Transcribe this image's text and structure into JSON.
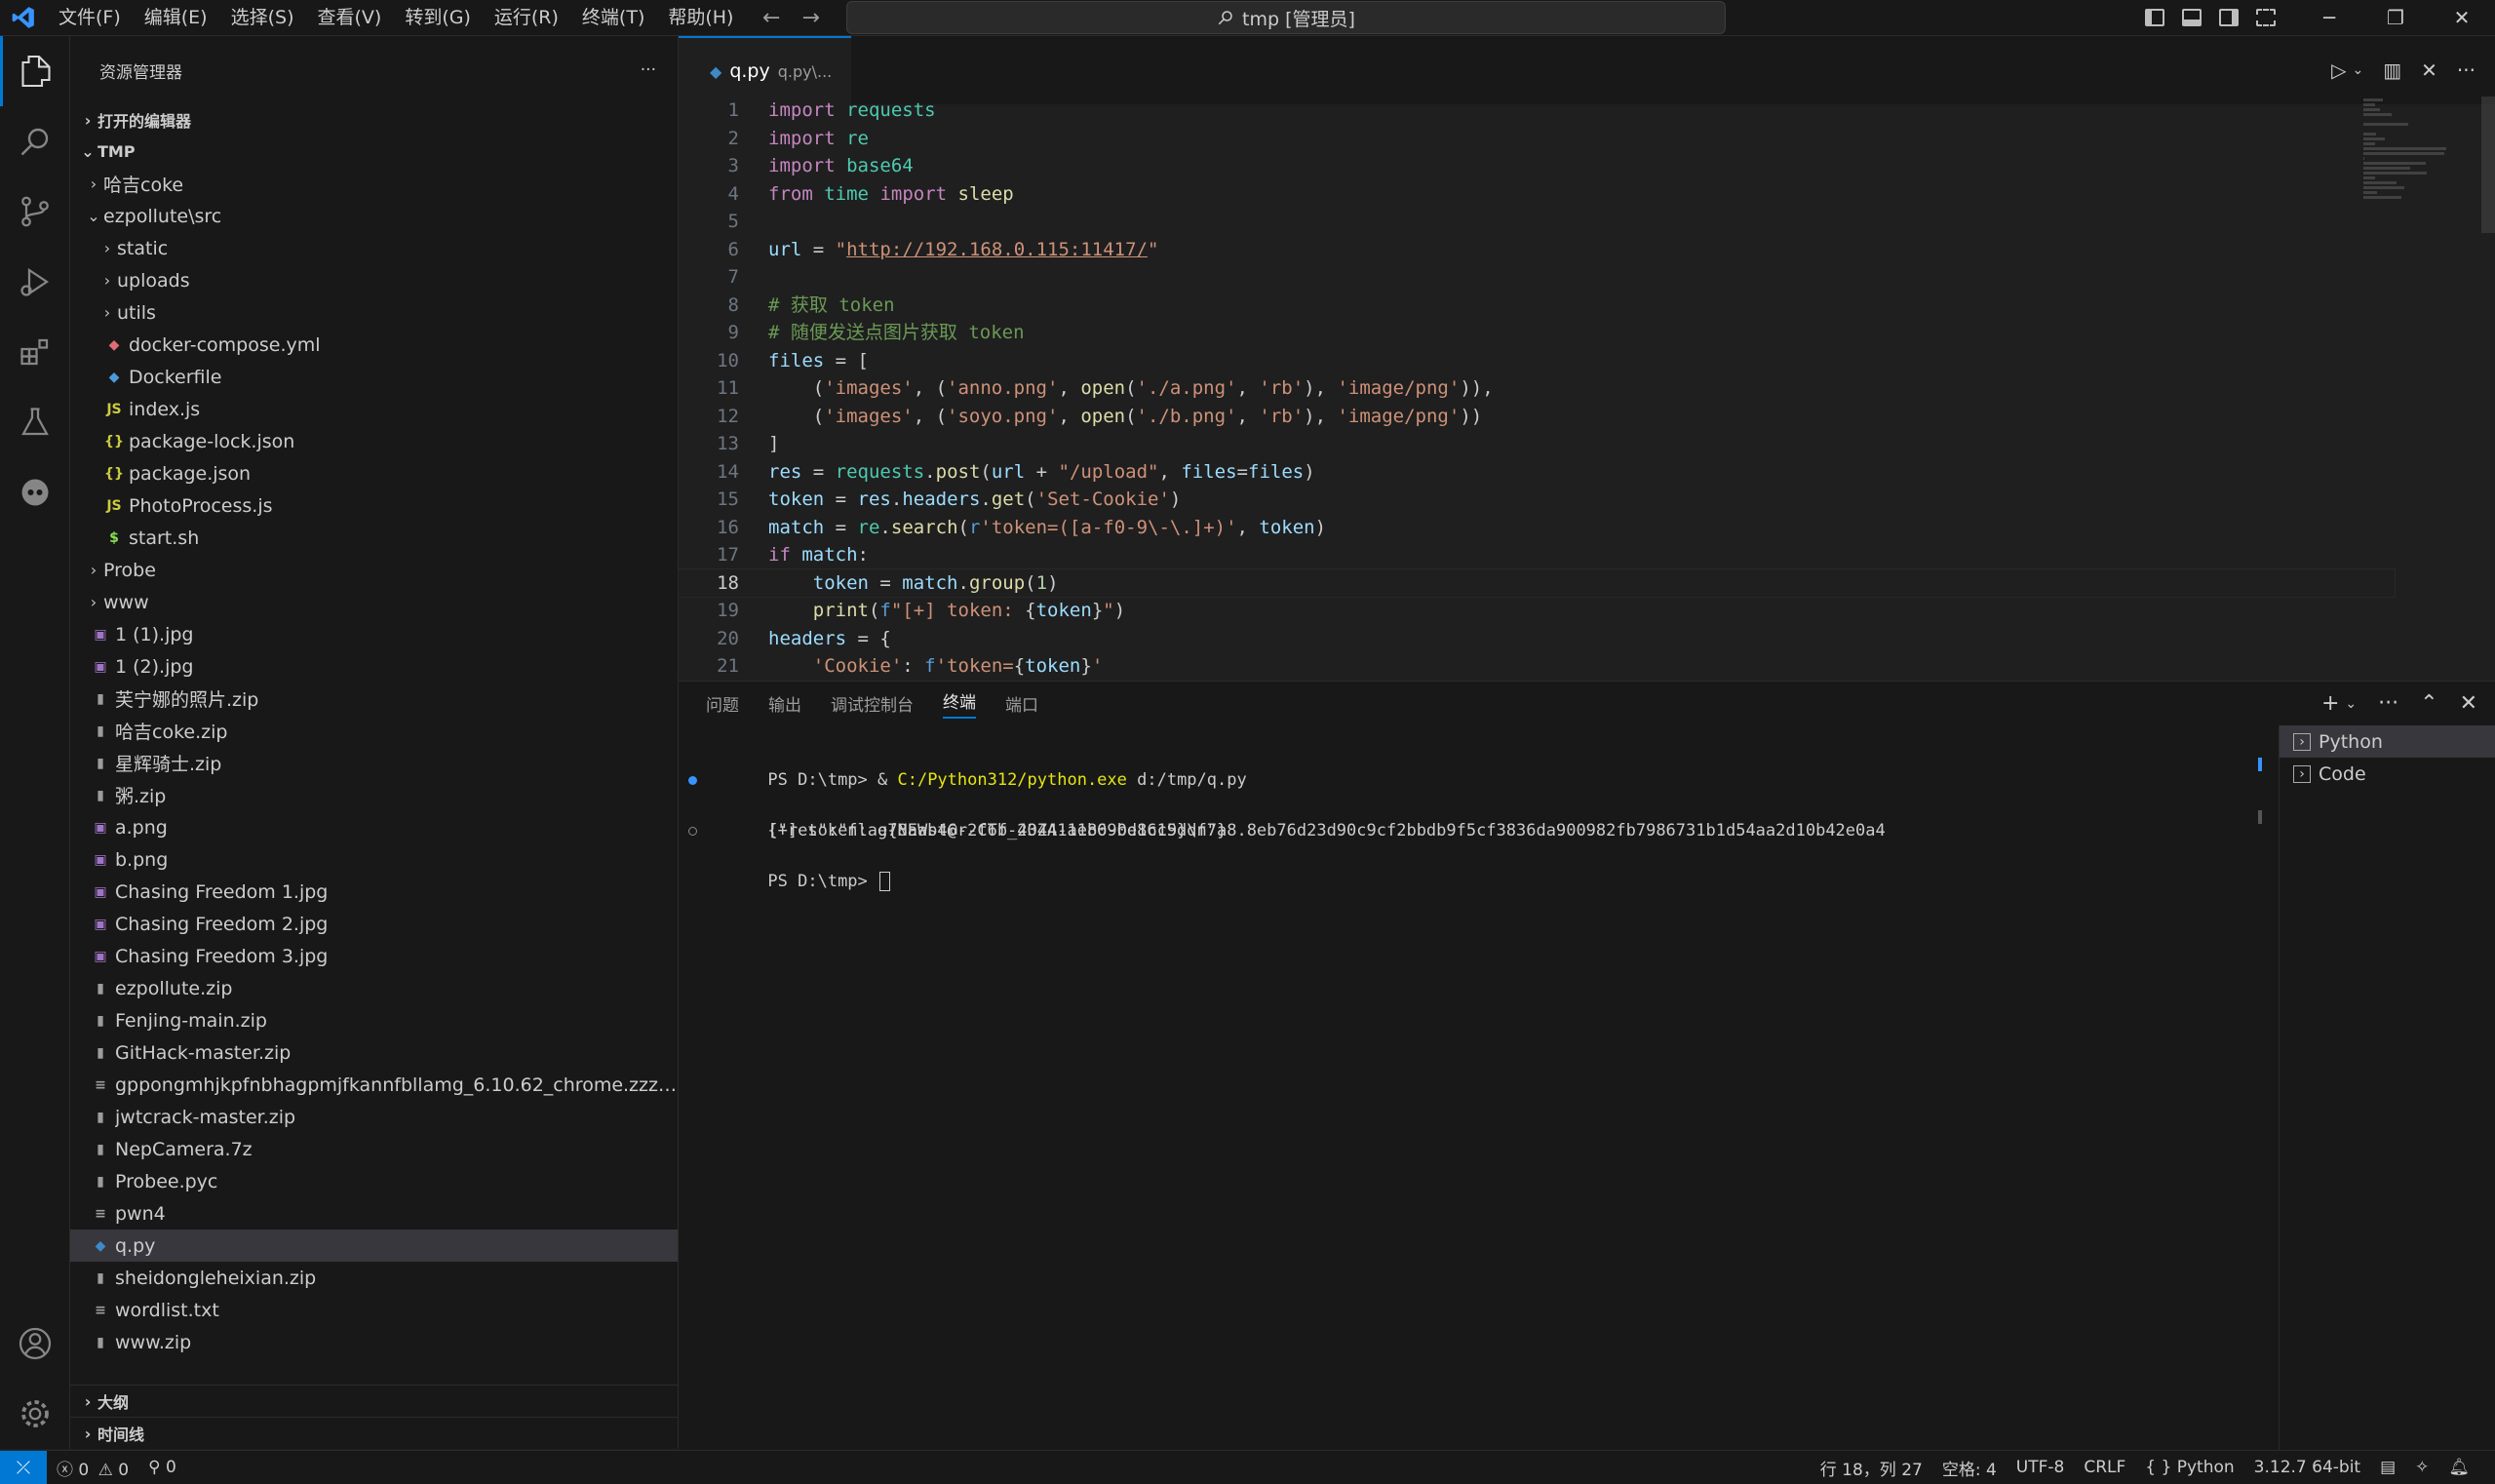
{
  "window": {
    "menus": [
      "文件(F)",
      "编辑(E)",
      "选择(S)",
      "查看(V)",
      "转到(G)",
      "运行(R)",
      "终端(T)",
      "帮助(H)"
    ],
    "search_label": "tmp [管理员]"
  },
  "sidebar": {
    "title": "资源管理器",
    "more": "···",
    "open_editors": "打开的编辑器",
    "root": "TMP",
    "tree": [
      {
        "label": "哈吉coke",
        "kind": "folder",
        "expanded": false,
        "depth": 1
      },
      {
        "label": "ezpollute\\src",
        "kind": "folder",
        "expanded": true,
        "depth": 1
      },
      {
        "label": "static",
        "kind": "folder",
        "expanded": false,
        "depth": 2
      },
      {
        "label": "uploads",
        "kind": "folder",
        "expanded": false,
        "depth": 2
      },
      {
        "label": "utils",
        "kind": "folder",
        "expanded": false,
        "depth": 2
      },
      {
        "label": "docker-compose.yml",
        "kind": "docker-compose",
        "depth": 2
      },
      {
        "label": "Dockerfile",
        "kind": "docker",
        "depth": 2
      },
      {
        "label": "index.js",
        "kind": "js",
        "depth": 2
      },
      {
        "label": "package-lock.json",
        "kind": "json",
        "depth": 2
      },
      {
        "label": "package.json",
        "kind": "json",
        "depth": 2
      },
      {
        "label": "PhotoProcess.js",
        "kind": "js",
        "depth": 2
      },
      {
        "label": "start.sh",
        "kind": "sh",
        "depth": 2
      },
      {
        "label": "Probe",
        "kind": "folder",
        "expanded": false,
        "depth": 1
      },
      {
        "label": "www",
        "kind": "folder",
        "expanded": false,
        "depth": 1
      },
      {
        "label": "1 (1).jpg",
        "kind": "image",
        "depth": 1
      },
      {
        "label": "1 (2).jpg",
        "kind": "image",
        "depth": 1
      },
      {
        "label": "芙宁娜的照片.zip",
        "kind": "zip",
        "depth": 1
      },
      {
        "label": "哈吉coke.zip",
        "kind": "zip",
        "depth": 1
      },
      {
        "label": "星辉骑士.zip",
        "kind": "zip",
        "depth": 1
      },
      {
        "label": "粥.zip",
        "kind": "zip",
        "depth": 1
      },
      {
        "label": "a.png",
        "kind": "image",
        "depth": 1
      },
      {
        "label": "b.png",
        "kind": "image",
        "depth": 1
      },
      {
        "label": "Chasing Freedom 1.jpg",
        "kind": "image",
        "depth": 1
      },
      {
        "label": "Chasing Freedom 2.jpg",
        "kind": "image",
        "depth": 1
      },
      {
        "label": "Chasing Freedom 3.jpg",
        "kind": "image",
        "depth": 1
      },
      {
        "label": "ezpollute.zip",
        "kind": "zip",
        "depth": 1
      },
      {
        "label": "Fenjing-main.zip",
        "kind": "zip",
        "depth": 1
      },
      {
        "label": "GitHack-master.zip",
        "kind": "zip",
        "depth": 1
      },
      {
        "label": "gppongmhjkpfnbhagpmjfkannfbllamg_6.10.62_chrome.zzzmh.cn...",
        "kind": "text",
        "depth": 1
      },
      {
        "label": "jwtcrack-master.zip",
        "kind": "zip",
        "depth": 1
      },
      {
        "label": "NepCamera.7z",
        "kind": "zip",
        "depth": 1
      },
      {
        "label": "Probee.pyc",
        "kind": "zip",
        "depth": 1
      },
      {
        "label": "pwn4",
        "kind": "text",
        "depth": 1
      },
      {
        "label": "q.py",
        "kind": "python",
        "depth": 1,
        "selected": true
      },
      {
        "label": "sheidongleheixian.zip",
        "kind": "zip",
        "depth": 1
      },
      {
        "label": "wordlist.txt",
        "kind": "text",
        "depth": 1
      },
      {
        "label": "www.zip",
        "kind": "zip",
        "depth": 1
      }
    ],
    "outline": "大纲",
    "timeline": "时间线"
  },
  "editor": {
    "tab_name": "q.py",
    "tab_desc": "q.py\\...",
    "current_line": 18,
    "code": [
      [
        [
          "k",
          "import"
        ],
        [
          "t",
          " "
        ],
        [
          "m",
          "requests"
        ]
      ],
      [
        [
          "k",
          "import"
        ],
        [
          "t",
          " "
        ],
        [
          "m",
          "re"
        ]
      ],
      [
        [
          "k",
          "import"
        ],
        [
          "t",
          " "
        ],
        [
          "m",
          "base64"
        ]
      ],
      [
        [
          "k",
          "from"
        ],
        [
          "t",
          " "
        ],
        [
          "m",
          "time"
        ],
        [
          "t",
          " "
        ],
        [
          "k",
          "import"
        ],
        [
          "t",
          " "
        ],
        [
          "f",
          "sleep"
        ]
      ],
      [],
      [
        [
          "v",
          "url"
        ],
        [
          "t",
          " = "
        ],
        [
          "s",
          "\""
        ],
        [
          "u",
          "http://192.168.0.115:11417/"
        ],
        [
          "s",
          "\""
        ]
      ],
      [],
      [
        [
          "c",
          "# 获取 token"
        ]
      ],
      [
        [
          "c",
          "# 随便发送点图片获取 token"
        ]
      ],
      [
        [
          "v",
          "files"
        ],
        [
          "t",
          " = ["
        ]
      ],
      [
        [
          "t",
          "    ("
        ],
        [
          "s",
          "'images'"
        ],
        [
          "t",
          ", ("
        ],
        [
          "s",
          "'anno.png'"
        ],
        [
          "t",
          ", "
        ],
        [
          "f",
          "open"
        ],
        [
          "t",
          "("
        ],
        [
          "s",
          "'./a.png'"
        ],
        [
          "t",
          ", "
        ],
        [
          "s",
          "'rb'"
        ],
        [
          "t",
          "), "
        ],
        [
          "s",
          "'image/png'"
        ],
        [
          "t",
          ")),"
        ]
      ],
      [
        [
          "t",
          "    ("
        ],
        [
          "s",
          "'images'"
        ],
        [
          "t",
          ", ("
        ],
        [
          "s",
          "'soyo.png'"
        ],
        [
          "t",
          ", "
        ],
        [
          "f",
          "open"
        ],
        [
          "t",
          "("
        ],
        [
          "s",
          "'./b.png'"
        ],
        [
          "t",
          ", "
        ],
        [
          "s",
          "'rb'"
        ],
        [
          "t",
          "), "
        ],
        [
          "s",
          "'image/png'"
        ],
        [
          "t",
          "))"
        ]
      ],
      [
        [
          "t",
          "]"
        ]
      ],
      [
        [
          "v",
          "res"
        ],
        [
          "t",
          " = "
        ],
        [
          "m",
          "requests"
        ],
        [
          "t",
          "."
        ],
        [
          "f",
          "post"
        ],
        [
          "t",
          "("
        ],
        [
          "v",
          "url"
        ],
        [
          "t",
          " + "
        ],
        [
          "s",
          "\"/upload\""
        ],
        [
          "t",
          ", "
        ],
        [
          "v",
          "files"
        ],
        [
          "t",
          "="
        ],
        [
          "v",
          "files"
        ],
        [
          "t",
          ")"
        ]
      ],
      [
        [
          "v",
          "token"
        ],
        [
          "t",
          " = "
        ],
        [
          "v",
          "res"
        ],
        [
          "t",
          "."
        ],
        [
          "v",
          "headers"
        ],
        [
          "t",
          "."
        ],
        [
          "f",
          "get"
        ],
        [
          "t",
          "("
        ],
        [
          "s",
          "'Set-Cookie'"
        ],
        [
          "t",
          ")"
        ]
      ],
      [
        [
          "v",
          "match"
        ],
        [
          "t",
          " = "
        ],
        [
          "m",
          "re"
        ],
        [
          "t",
          "."
        ],
        [
          "f",
          "search"
        ],
        [
          "t",
          "("
        ],
        [
          "kb",
          "r"
        ],
        [
          "s",
          "'token=([a-f0-9\\-\\.]+)'"
        ],
        [
          "t",
          ", "
        ],
        [
          "v",
          "token"
        ],
        [
          "t",
          ")"
        ]
      ],
      [
        [
          "k",
          "if"
        ],
        [
          "t",
          " "
        ],
        [
          "v",
          "match"
        ],
        [
          "t",
          ":"
        ]
      ],
      [
        [
          "t",
          "    "
        ],
        [
          "v",
          "token"
        ],
        [
          "t",
          " = "
        ],
        [
          "v",
          "match"
        ],
        [
          "t",
          "."
        ],
        [
          "f",
          "group"
        ],
        [
          "t",
          "("
        ],
        [
          "n",
          "1"
        ],
        [
          "t",
          ")"
        ]
      ],
      [
        [
          "t",
          "    "
        ],
        [
          "f",
          "print"
        ],
        [
          "t",
          "("
        ],
        [
          "kb",
          "f"
        ],
        [
          "s",
          "\"[+] token: "
        ],
        [
          "t",
          "{"
        ],
        [
          "v",
          "token"
        ],
        [
          "t",
          "}"
        ],
        [
          "s",
          "\""
        ],
        [
          "t",
          ")"
        ]
      ],
      [
        [
          "v",
          "headers"
        ],
        [
          "t",
          " = {"
        ]
      ],
      [
        [
          "t",
          "    "
        ],
        [
          "s",
          "'Cookie'"
        ],
        [
          "t",
          ": "
        ],
        [
          "kb",
          "f"
        ],
        [
          "s",
          "'token="
        ],
        [
          "t",
          "{"
        ],
        [
          "v",
          "token"
        ],
        [
          "t",
          "}"
        ],
        [
          "s",
          "'"
        ]
      ]
    ]
  },
  "panel": {
    "tabs": [
      "问题",
      "输出",
      "调试控制台",
      "终端",
      "端口"
    ],
    "active_tab": "终端",
    "terminal": {
      "prompt1": "PS D:\\tmp> & ",
      "cmd_exe": "C:/Python312/python.exe",
      "cmd_arg": " d:/tmp/q.py",
      "line2": "[+] token: e78aab46-2f6b-4344-ae80-0d1c19ddf7a8.8eb76d23d90c9cf2bbdb9f5cf3836da900982fb7986731b1d54aa2d10b42e0a4",
      "line3": "{\"res\":\"flag{NEWst@r-CTf_2OZA111b69be86c5}\\n\"}",
      "prompt2": "PS D:\\tmp> "
    },
    "terminal_list": [
      "Python",
      "Code"
    ]
  },
  "status": {
    "errors": "0",
    "warnings": "0",
    "ports": "0",
    "position": "行 18，列 27",
    "spaces": "空格: 4",
    "encoding": "UTF-8",
    "eol": "CRLF",
    "language": "Python",
    "interpreter": "3.12.7 64-bit"
  },
  "colors": {
    "accent": "#0078d4",
    "editor_bg": "#1f1f1f",
    "chrome_bg": "#181818"
  }
}
